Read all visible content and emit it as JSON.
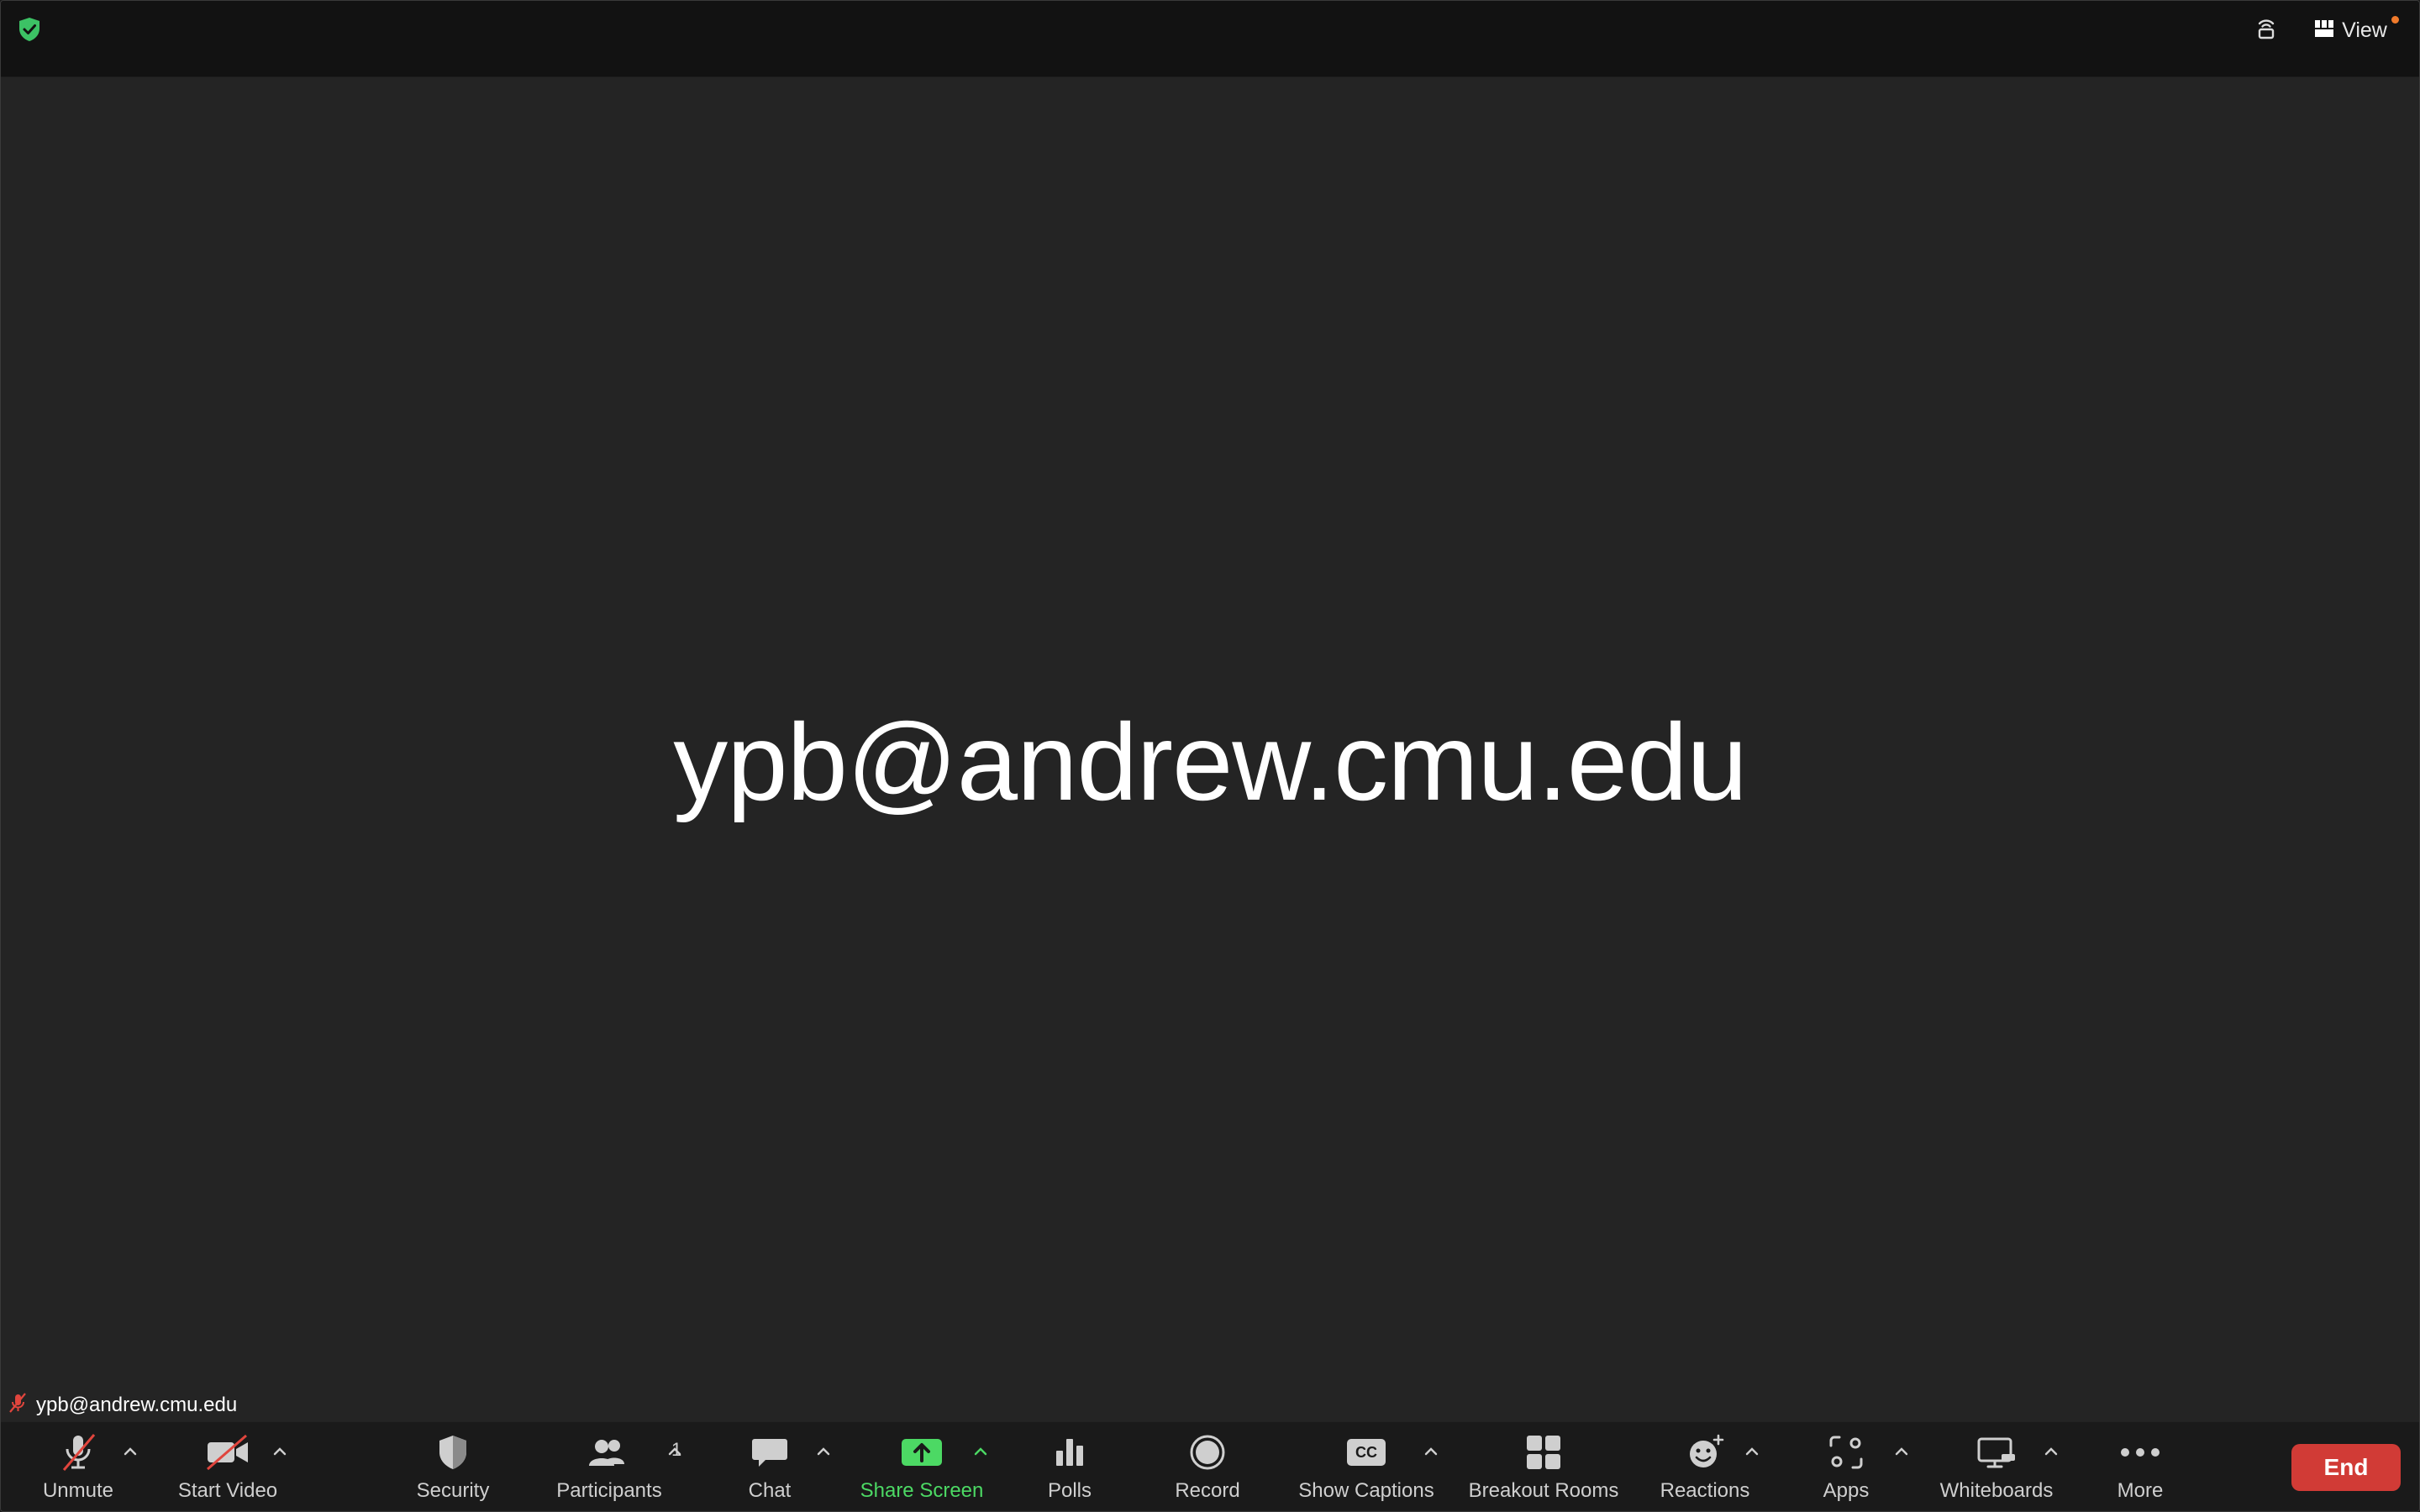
{
  "window": {
    "view_label": "View"
  },
  "stage": {
    "participant_name": "ypb@andrew.cmu.edu",
    "name_tag": "ypb@andrew.cmu.edu"
  },
  "toolbar": {
    "unmute": "Unmute",
    "start_video": "Start Video",
    "security": "Security",
    "participants": "Participants",
    "participant_count": "1",
    "chat": "Chat",
    "share_screen": "Share Screen",
    "polls": "Polls",
    "record": "Record",
    "show_captions": "Show Captions",
    "captions_badge": "CC",
    "breakout_rooms": "Breakout Rooms",
    "reactions": "Reactions",
    "apps": "Apps",
    "whiteboards": "Whiteboards",
    "more": "More",
    "end": "End"
  },
  "colors": {
    "accent_green": "#4cd964",
    "end_red": "#d13b36",
    "muted_red": "#e0453d",
    "notification_orange": "#f07a2b"
  },
  "icons": {
    "encryption": "shield-check-icon",
    "layout": "wireless-share-icon",
    "view": "grid-view-icon"
  }
}
